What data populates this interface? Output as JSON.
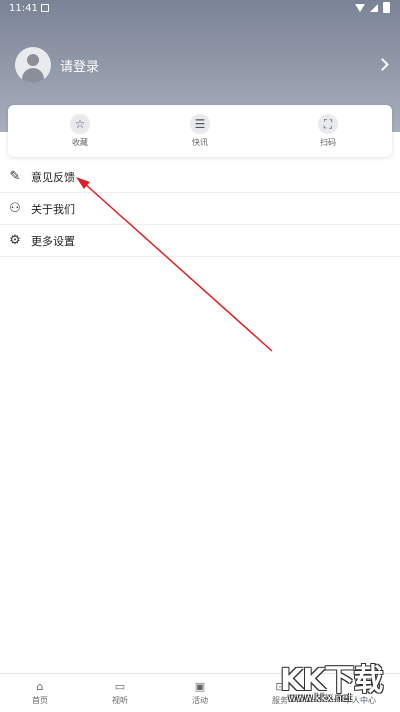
{
  "status_bar": {
    "time": "11:41"
  },
  "profile": {
    "login_label": "请登录"
  },
  "quick_actions": [
    {
      "label": "收藏",
      "icon": "star-icon"
    },
    {
      "label": "快讯",
      "icon": "news-list-icon"
    },
    {
      "label": "扫码",
      "icon": "scan-icon"
    }
  ],
  "menu": [
    {
      "label": "意见反馈",
      "icon": "edit-icon"
    },
    {
      "label": "关于我们",
      "icon": "users-icon"
    },
    {
      "label": "更多设置",
      "icon": "gear-icon"
    }
  ],
  "tabs": [
    {
      "label": "首页",
      "icon": "home-icon"
    },
    {
      "label": "视听",
      "icon": "tv-icon"
    },
    {
      "label": "活动",
      "icon": "video-icon"
    },
    {
      "label": "服务",
      "icon": "service-icon"
    },
    {
      "label": "个人中心",
      "icon": "user-heart-icon",
      "active": true
    }
  ],
  "watermark": {
    "main": "KK下载",
    "url": "www.kkx.net"
  },
  "colors": {
    "header_top": "#7a8396",
    "annotation_arrow": "#e02020",
    "active_tab": "#4f5a78"
  }
}
